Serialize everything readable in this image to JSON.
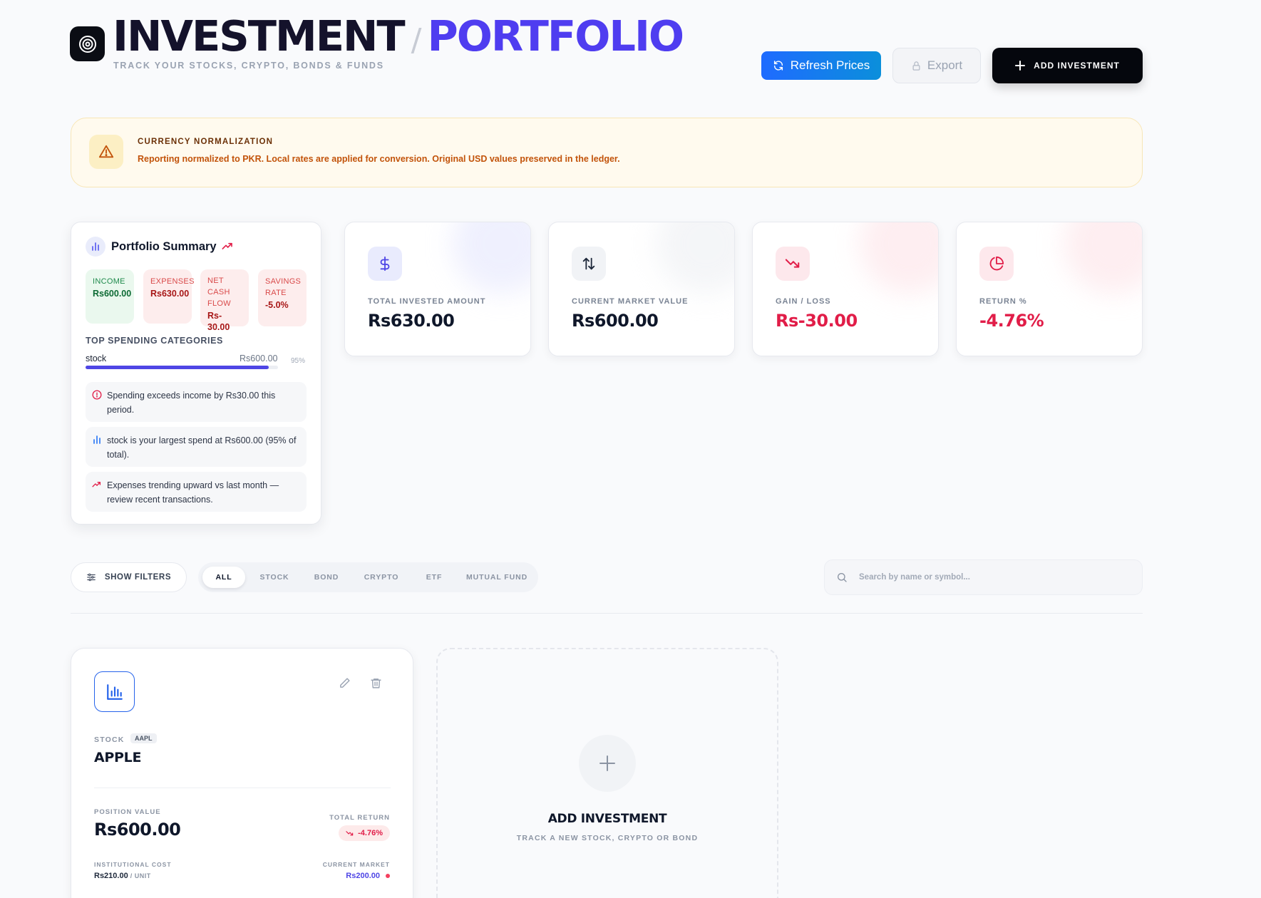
{
  "header": {
    "title_part1": "INVESTMENT",
    "title_separator": "/",
    "title_part2": "PORTFOLIO",
    "subtitle": "TRACK YOUR STOCKS, CRYPTO, BONDS & FUNDS",
    "refresh_label": "Refresh Prices",
    "export_label": "Export",
    "add_label": "ADD INVESTMENT"
  },
  "notice": {
    "title": "CURRENCY NORMALIZATION",
    "text": "Reporting normalized to PKR. Local rates are applied for conversion. Original USD values preserved in the ledger."
  },
  "summary": {
    "title": "Portfolio Summary",
    "income_label": "INCOME",
    "income_value": "Rs600.00",
    "expenses_label": "EXPENSES",
    "expenses_value": "Rs630.00",
    "net_label_1": "NET",
    "net_label_2": "CASH",
    "net_label_3": "FLOW",
    "net_value": "Rs-30.00",
    "savings_label_1": "SAVINGS",
    "savings_label_2": "RATE",
    "savings_value": "-5.0%",
    "categories_heading": "TOP SPENDING CATEGORIES",
    "categories": [
      {
        "name": "stock",
        "amount": "Rs600.00",
        "percent_label": "95%",
        "fraction": 0.95
      }
    ],
    "insights": [
      "Spending exceeds income by Rs30.00 this period.",
      "stock is your largest spend at Rs600.00 (95% of total).",
      "Expenses trending upward vs last month — review recent transactions."
    ]
  },
  "stats": [
    {
      "label": "TOTAL INVESTED AMOUNT",
      "value": "Rs630.00",
      "icon": "dollar-icon"
    },
    {
      "label": "CURRENT MARKET VALUE",
      "value": "Rs600.00",
      "icon": "arrows-up-down-icon"
    },
    {
      "label": "GAIN / LOSS",
      "value": "Rs-30.00",
      "icon": "trend-down-icon"
    },
    {
      "label": "RETURN %",
      "value": "-4.76%",
      "icon": "pie-chart-icon"
    }
  ],
  "colors": {
    "accent": "#4f3df0",
    "negative": "#e11d48",
    "positive": "#0d6b34",
    "refresh_button": "#1f6bff"
  },
  "filters": {
    "show_filters_label": "SHOW FILTERS",
    "tabs": [
      "ALL",
      "STOCK",
      "BOND",
      "CRYPTO",
      "ETF",
      "MUTUAL FUND"
    ],
    "active_tab": "ALL",
    "search_placeholder": "Search by name or symbol..."
  },
  "holdings": [
    {
      "type": "STOCK",
      "symbol": "AAPL",
      "name": "APPLE",
      "position_value_label": "POSITION VALUE",
      "position_value": "Rs600.00",
      "total_return_label": "TOTAL RETURN",
      "total_return": "-4.76%",
      "cost_label": "INSTITUTIONAL COST",
      "cost": "Rs210.00",
      "cost_unit": "/ UNIT",
      "market_label": "CURRENT MARKET",
      "market": "Rs200.00"
    }
  ],
  "add_card": {
    "title": "ADD INVESTMENT",
    "subtitle": "TRACK A NEW STOCK, CRYPTO OR BOND"
  }
}
